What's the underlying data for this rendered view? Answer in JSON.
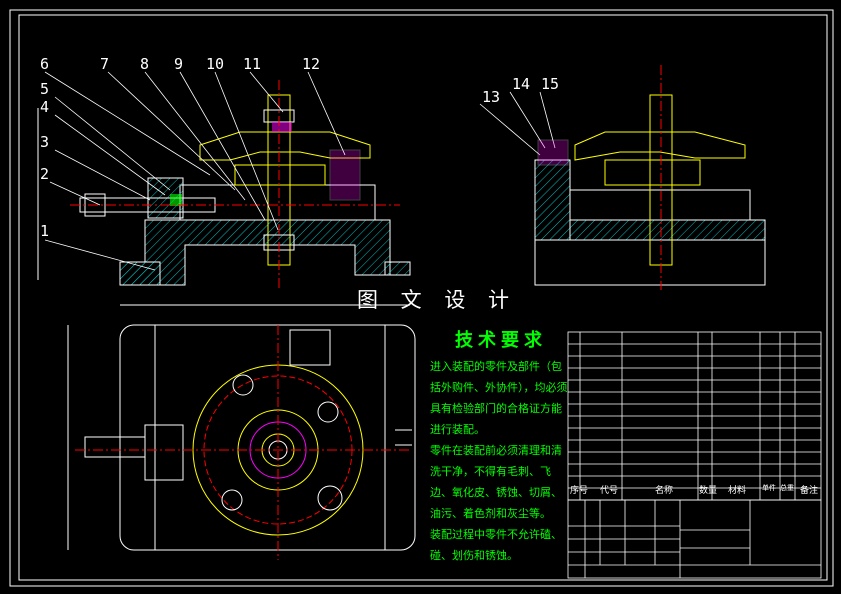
{
  "drawing": {
    "watermark": "图 文 设 计",
    "tech_title": "技术要求",
    "tech_notes": [
      "进入装配的零件及部件（包括外购件、外协件），均必须具有检验部门的合格证方能进行装配。",
      "零件在装配前必须清理和清洗干净，不得有毛刺、飞边、氧化皮、锈蚀、切屑、油污、着色剂和灰尘等。",
      "装配过程中零件不允许磕、碰、划伤和锈蚀。"
    ],
    "part_labels": [
      "1",
      "2",
      "3",
      "4",
      "5",
      "6",
      "7",
      "8",
      "9",
      "10",
      "11",
      "12",
      "13",
      "14",
      "15"
    ],
    "bom_header": [
      "序号",
      "代号",
      "名称",
      "数量",
      "材料",
      "单件",
      "总重",
      "备注"
    ],
    "colors": {
      "background": "#000000",
      "outline": "#ffffff",
      "part": "#ffff00",
      "center_line": "#ff0000",
      "hatch": "#00c0c0",
      "highlight": "#ff00ff",
      "notes": "#00ff00"
    }
  }
}
